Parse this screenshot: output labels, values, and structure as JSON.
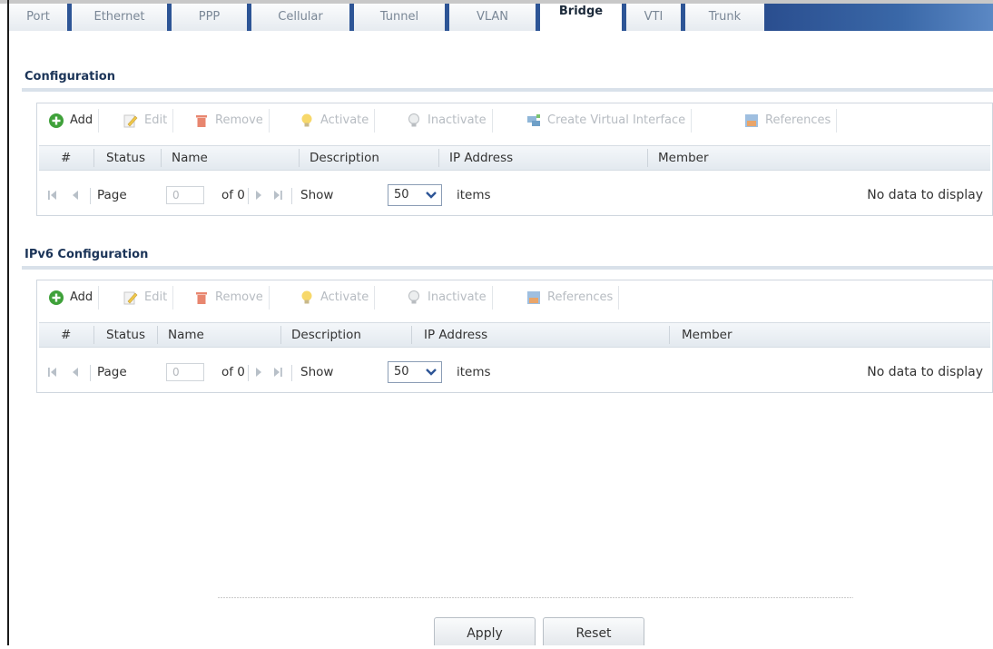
{
  "tabs": [
    "Port",
    "Ethernet",
    "PPP",
    "Cellular",
    "Tunnel",
    "VLAN",
    "Bridge",
    "VTI",
    "Trunk"
  ],
  "active_tab": "Bridge",
  "sections": [
    {
      "title": "Configuration",
      "toolbar": {
        "add": "Add",
        "edit": "Edit",
        "remove": "Remove",
        "activate": "Activate",
        "inactivate": "Inactivate",
        "create_virtual": "Create Virtual Interface",
        "references": "References"
      },
      "columns": [
        "#",
        "Status",
        "Name",
        "Description",
        "IP Address",
        "Member"
      ],
      "pager": {
        "page_label": "Page",
        "page_value": "0",
        "of_label": "of 0",
        "show_label": "Show",
        "show_value": "50",
        "items_label": "items",
        "empty_text": "No data to display"
      }
    },
    {
      "title": "IPv6 Configuration",
      "toolbar": {
        "add": "Add",
        "edit": "Edit",
        "remove": "Remove",
        "activate": "Activate",
        "inactivate": "Inactivate",
        "references": "References"
      },
      "columns": [
        "#",
        "Status",
        "Name",
        "Description",
        "IP Address",
        "Member"
      ],
      "pager": {
        "page_label": "Page",
        "page_value": "0",
        "of_label": "of 0",
        "show_label": "Show",
        "show_value": "50",
        "items_label": "items",
        "empty_text": "No data to display"
      }
    }
  ],
  "buttons": {
    "apply": "Apply",
    "reset": "Reset"
  },
  "icons": {
    "add": "plus-circle-icon",
    "edit": "pencil-icon",
    "remove": "trash-icon",
    "activate": "lightbulb-icon",
    "inactivate": "lightbulb-off-icon",
    "create_virtual": "network-icon",
    "references": "references-icon",
    "first": "first-page-icon",
    "prev": "prev-page-icon",
    "next": "next-page-icon",
    "last": "last-page-icon",
    "dropdown": "chevron-down-icon"
  },
  "colors": {
    "accent": "#2d5596",
    "add_green": "#3fa13a",
    "header_blue": "#1b3458",
    "disabled": "#b7bcc2"
  }
}
